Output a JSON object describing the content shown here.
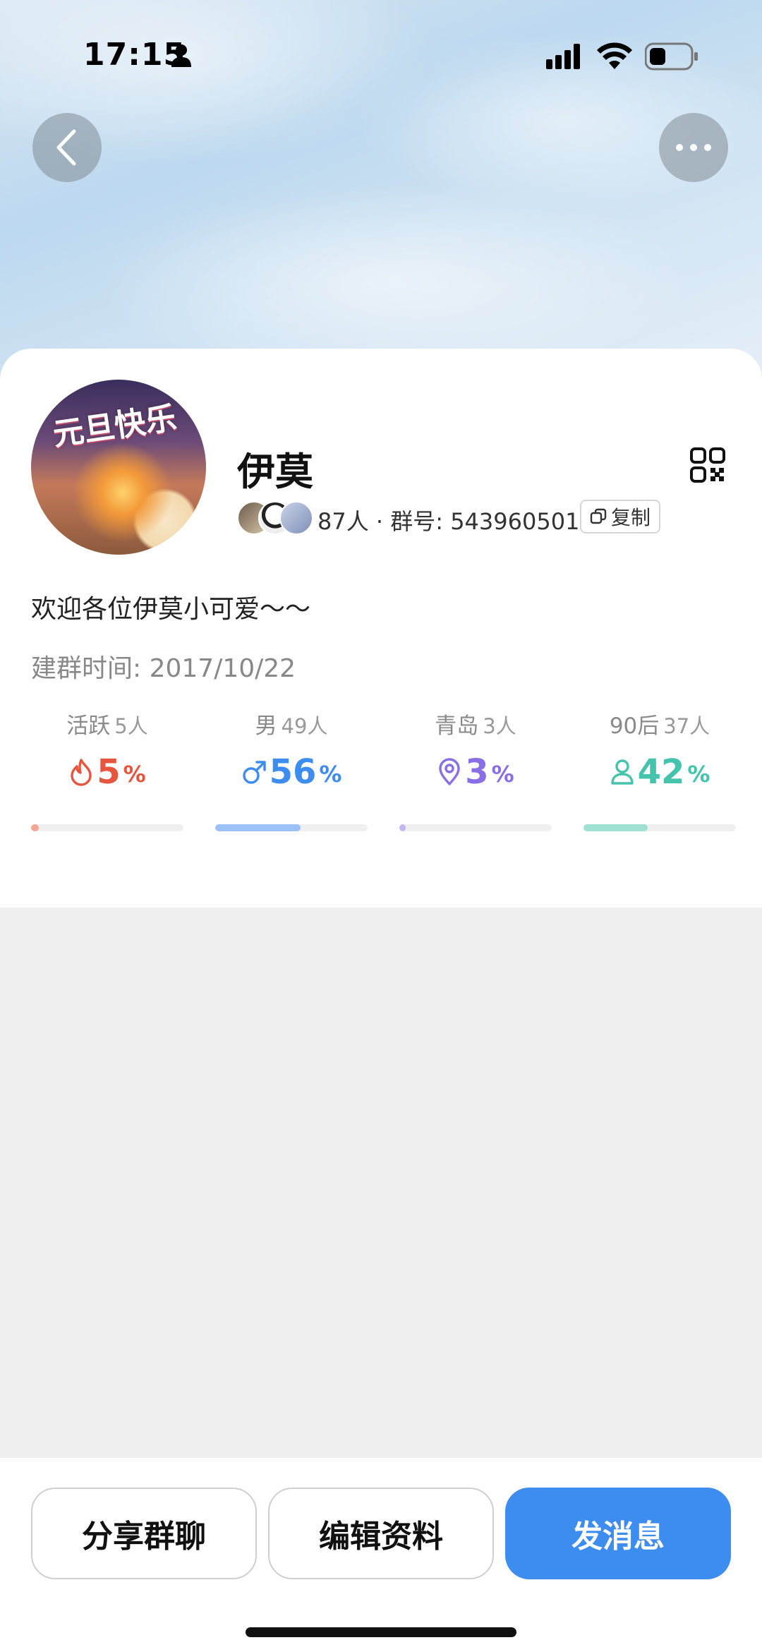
{
  "status_bar": {
    "time": "17:15",
    "icons": [
      "person-icon",
      "signal-icon",
      "wifi-icon",
      "battery-icon"
    ]
  },
  "nav": {
    "back_icon": "chevron-left-icon",
    "more_icon": "ellipsis-icon"
  },
  "group": {
    "avatar_text": "元旦快乐",
    "name": "伊莫",
    "member_info": "87人 · 群号: 543960501",
    "copy_label": "复制",
    "welcome": "欢迎各位伊莫小可爱～～",
    "created": "建群时间: 2017/10/22"
  },
  "stats": [
    {
      "label": "活跃",
      "count": "5人",
      "value": "5",
      "unit": "%",
      "icon": "flame-icon",
      "color": "#e8553f",
      "track_color": "#f5a596",
      "fraction": 0.05
    },
    {
      "label": "男",
      "count": "49人",
      "value": "56",
      "unit": "%",
      "icon": "male-icon",
      "color": "#3d8cf0",
      "track_color": "#9cc1f6",
      "fraction": 0.56
    },
    {
      "label": "青岛",
      "count": "3人",
      "value": "3",
      "unit": "%",
      "icon": "location-icon",
      "color": "#8a6ee6",
      "track_color": "#c3b6f2",
      "fraction": 0.03
    },
    {
      "label": "90后",
      "count": "37人",
      "value": "42",
      "unit": "%",
      "icon": "person-outline-icon",
      "color": "#45c4ad",
      "track_color": "#9fe0d3",
      "fraction": 0.42
    }
  ],
  "actions": {
    "share": "分享群聊",
    "edit": "编辑资料",
    "send": "发消息"
  }
}
